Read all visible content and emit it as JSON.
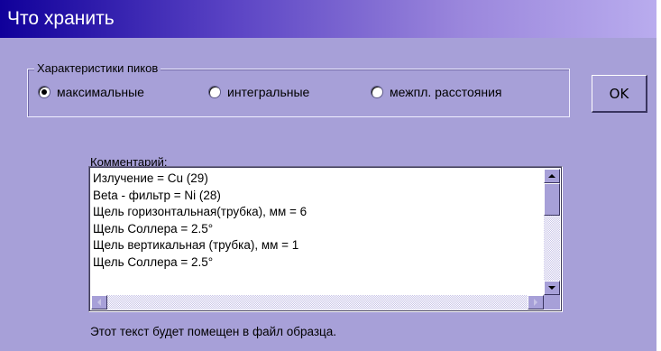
{
  "window": {
    "title": "Что хранить",
    "bg_color": "#a7a0d8"
  },
  "peak_characteristics": {
    "label": "Характеристики пиков",
    "options": [
      {
        "label": "максимальные",
        "checked": true
      },
      {
        "label": "интегральные",
        "checked": false
      },
      {
        "label": "межпл. расстояния",
        "checked": false
      }
    ]
  },
  "ok_button": {
    "label": "OK"
  },
  "comment": {
    "label": "Комментарий:",
    "lines": [
      "Излучение = Cu (29)",
      "Beta - фильтр = Ni (28)",
      "Щель горизонтальная(трубка), мм = 6",
      "Щель Соллера = 2.5°",
      "Щель вертикальная (трубка), мм = 1",
      "Щель Соллера = 2.5°",
      ""
    ]
  },
  "scrollbar_icons": {
    "up": "arrow-up-icon",
    "down": "arrow-down-icon",
    "left": "arrow-left-icon",
    "right": "arrow-right-icon"
  },
  "note": "Этот текст будет помещен в файл образца."
}
